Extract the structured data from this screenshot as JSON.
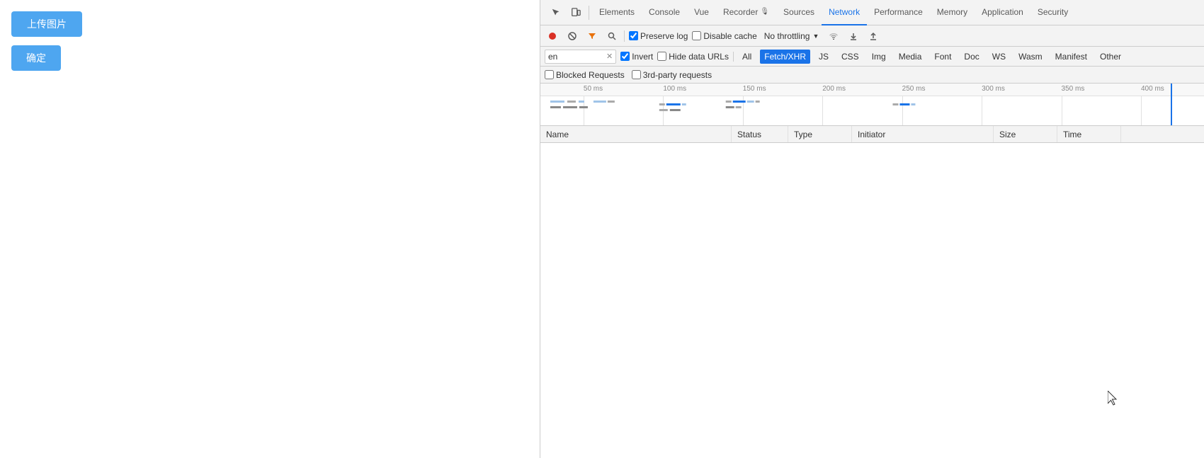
{
  "left_panel": {
    "upload_btn_label": "上传图片",
    "confirm_btn_label": "确定"
  },
  "devtools": {
    "tabs": [
      {
        "id": "elements",
        "label": "Elements"
      },
      {
        "id": "console",
        "label": "Console"
      },
      {
        "id": "vue",
        "label": "Vue"
      },
      {
        "id": "recorder",
        "label": "Recorder"
      },
      {
        "id": "sources",
        "label": "Sources"
      },
      {
        "id": "network",
        "label": "Network"
      },
      {
        "id": "performance",
        "label": "Performance"
      },
      {
        "id": "memory",
        "label": "Memory"
      },
      {
        "id": "application",
        "label": "Application"
      },
      {
        "id": "security",
        "label": "Security"
      }
    ],
    "active_tab": "network",
    "network": {
      "toolbar": {
        "preserve_log_label": "Preserve log",
        "disable_cache_label": "Disable cache",
        "no_throttling_label": "No throttling",
        "preserve_log_checked": true,
        "disable_cache_checked": false
      },
      "filter": {
        "input_value": "en",
        "invert_label": "Invert",
        "invert_checked": true,
        "hide_data_urls_label": "Hide data URLs",
        "hide_data_urls_checked": false,
        "types": [
          "All",
          "Fetch/XHR",
          "JS",
          "CSS",
          "Img",
          "Media",
          "Font",
          "Doc",
          "WS",
          "Wasm",
          "Manifest",
          "Other"
        ],
        "active_type": "Fetch/XHR"
      },
      "blocked": {
        "blocked_label": "Blocked Requests",
        "third_party_label": "3rd-party requests"
      },
      "timeline": {
        "marks": [
          {
            "label": "50 ms",
            "pos_pct": 6.5
          },
          {
            "label": "100 ms",
            "pos_pct": 18.5
          },
          {
            "label": "150 ms",
            "pos_pct": 30.5
          },
          {
            "label": "200 ms",
            "pos_pct": 42.5
          },
          {
            "label": "250 ms",
            "pos_pct": 54.5
          },
          {
            "label": "300 ms",
            "pos_pct": 66.5
          },
          {
            "label": "350 ms",
            "pos_pct": 78.5
          },
          {
            "label": "400 ms",
            "pos_pct": 90.5
          }
        ]
      },
      "table": {
        "columns": [
          {
            "id": "name",
            "label": "Name"
          },
          {
            "id": "status",
            "label": "Status"
          },
          {
            "id": "type",
            "label": "Type"
          },
          {
            "id": "initiator",
            "label": "Initiator"
          },
          {
            "id": "size",
            "label": "Size"
          },
          {
            "id": "time",
            "label": "Time"
          },
          {
            "id": "waterfall",
            "label": ""
          }
        ],
        "rows": []
      }
    }
  }
}
